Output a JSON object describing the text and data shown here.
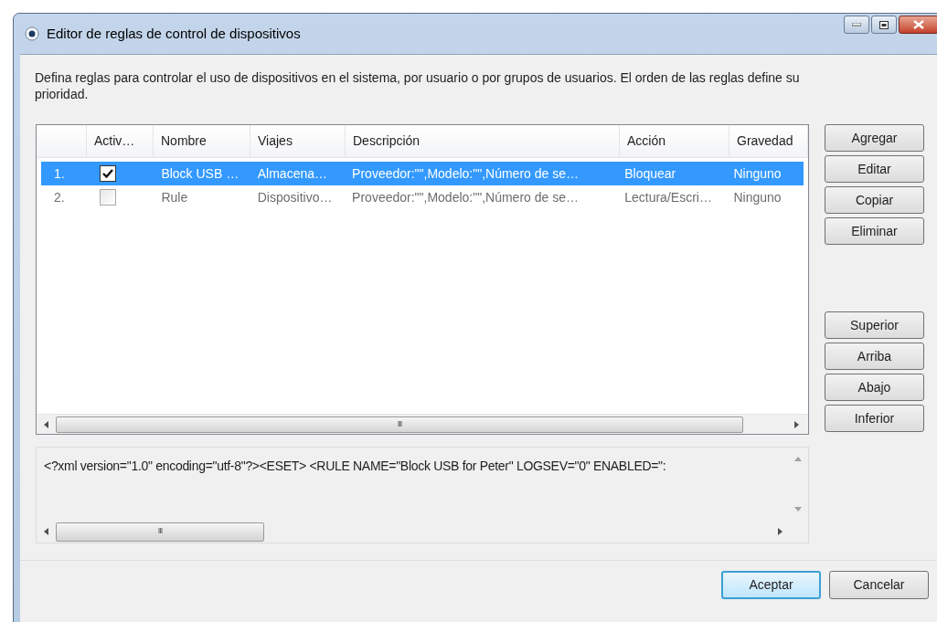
{
  "window": {
    "title": "Editor de reglas de control de dispositivos"
  },
  "description": "Defina reglas para controlar el uso de dispositivos en el sistema, por usuario o por grupos de usuarios. El orden de las reglas define su prioridad.",
  "table": {
    "columns": [
      "",
      "Activ…",
      "Nombre",
      "Viajes",
      "Descripción",
      "Acción",
      "Gravedad"
    ],
    "rows": [
      {
        "checked": true,
        "selected": true,
        "cells": [
          "1.",
          "",
          "Block USB …",
          "Almacena…",
          "Proveedor:\"\",Modelo:\"\",Número de se…",
          "Bloquear",
          "Ninguno"
        ]
      },
      {
        "checked": false,
        "selected": false,
        "cells": [
          "2.",
          "",
          "Rule",
          "Dispositivo…",
          "Proveedor:\"\",Modelo:\"\",Número de se…",
          "Lectura/Escri…",
          "Ninguno"
        ]
      }
    ],
    "scroll_thumb": "III"
  },
  "xml": {
    "text": "<?xml version=\"1.0\" encoding=\"utf-8\"?><ESET> <RULE NAME=\"Block USB for Peter\" LOGSEV=\"0\" ENABLED=\":",
    "scroll_thumb": "III"
  },
  "side_buttons": [
    [
      "Agregar",
      "Editar",
      "Copiar",
      "Eliminar"
    ],
    [
      "Superior",
      "Arriba",
      "Abajo",
      "Inferior"
    ]
  ],
  "buttons": [
    {
      "label": "Aceptar",
      "default": true
    },
    {
      "label": "Cancelar",
      "default": false
    }
  ]
}
